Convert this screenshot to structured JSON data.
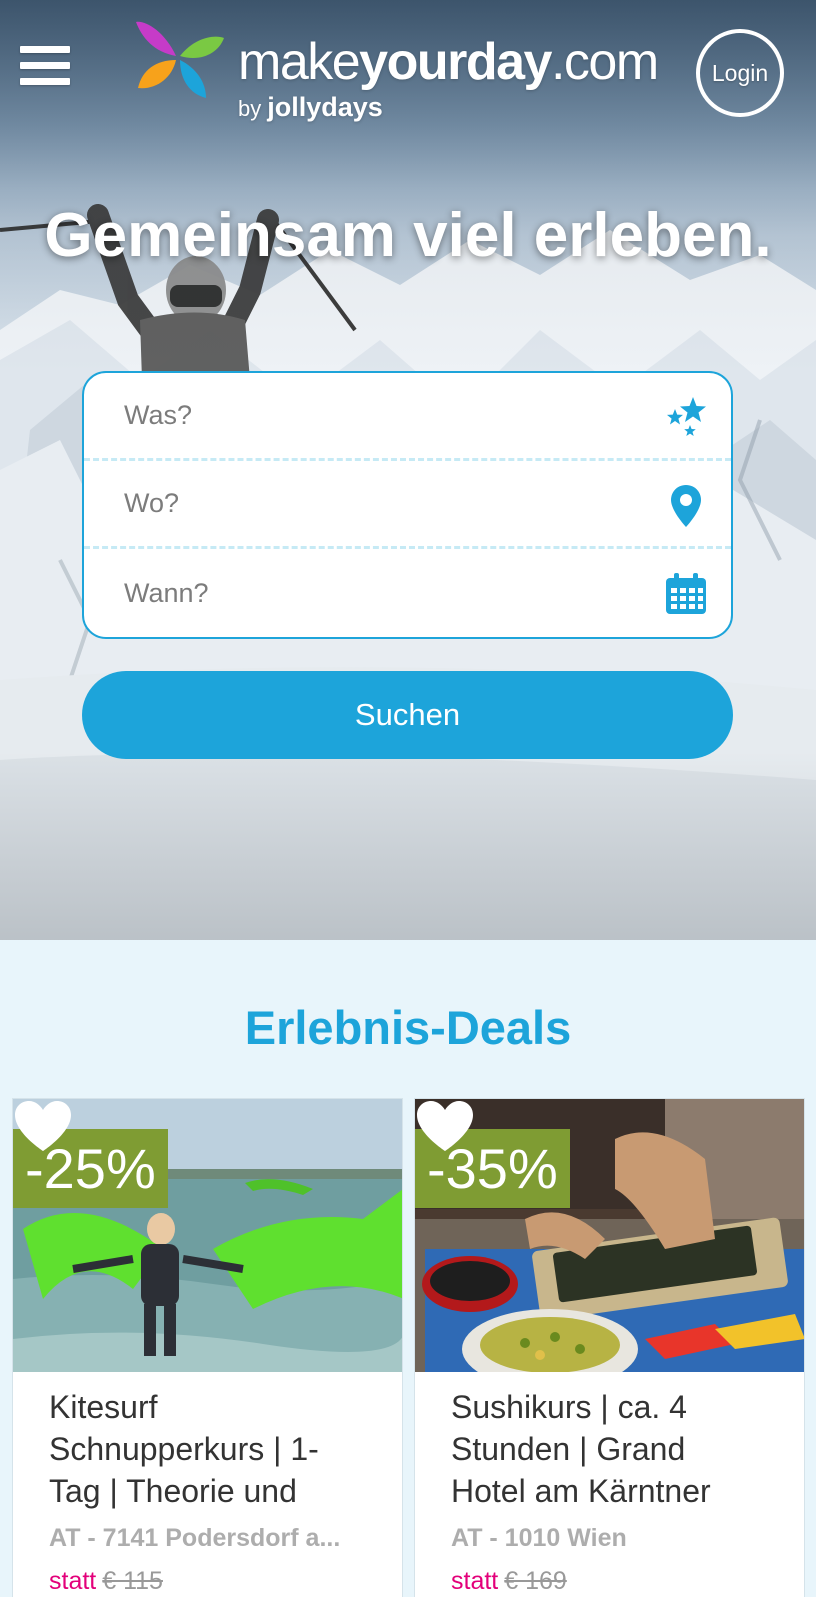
{
  "header": {
    "logo": {
      "word_thin_1": "make",
      "word_bold_1": "your",
      "word_bold_2": "day",
      "word_thin_2": ".com",
      "by": "by",
      "brand": "jollydays"
    },
    "login_label": "Login"
  },
  "hero": {
    "title": "Gemeinsam viel erleben."
  },
  "search": {
    "what_placeholder": "Was?",
    "where_placeholder": "Wo?",
    "when_placeholder": "Wann?",
    "button_label": "Suchen",
    "icons": [
      "stars-icon",
      "map-pin-icon",
      "calendar-icon"
    ]
  },
  "deals": {
    "title": "Erlebnis-Deals",
    "items": [
      {
        "discount": "-25%",
        "title": "Kitesurf Schnupperkurs | 1-Tag | Theorie und",
        "location": "AT - 7141 Podersdorf a...",
        "price_prefix": "statt",
        "old_price": "€ 115",
        "image": "kitesurf-photo"
      },
      {
        "discount": "-35%",
        "title": "Sushikurs | ca. 4 Stunden | Grand Hotel am Kärntner",
        "location": "AT - 1010 Wien",
        "price_prefix": "statt",
        "old_price": "€ 169",
        "image": "sushi-photo"
      }
    ]
  },
  "colors": {
    "accent": "#1da4da",
    "discount": "#7f9c33",
    "price": "#e3007a",
    "background": "#e8f5fb"
  }
}
